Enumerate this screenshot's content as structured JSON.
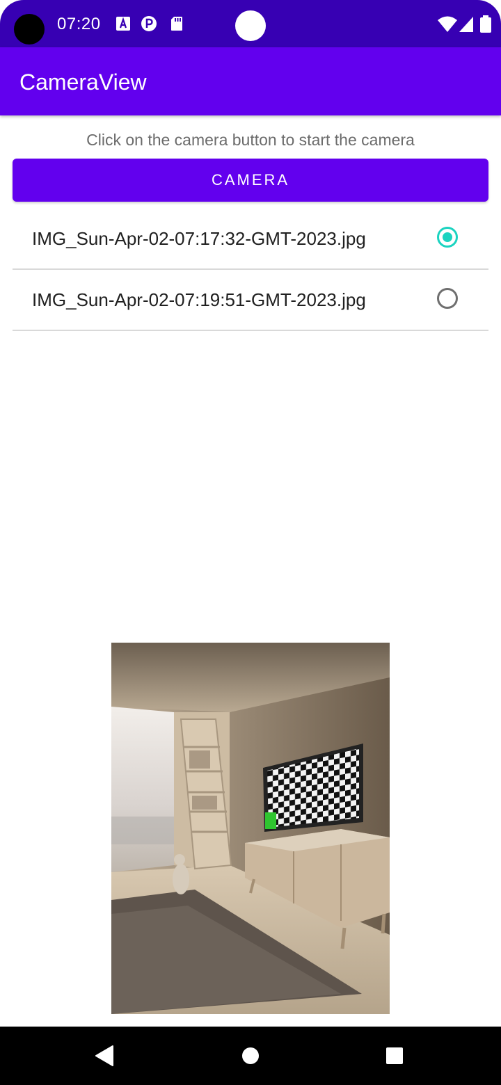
{
  "status_bar": {
    "time": "07:20",
    "notification_icons": [
      "text-a-icon",
      "p-circle-icon",
      "sd-card-icon"
    ],
    "right_icons": [
      "wifi-icon",
      "signal-icon",
      "battery-icon"
    ],
    "background_color": "#3700b3"
  },
  "app_bar": {
    "title": "CameraView",
    "background_color": "#6200ee"
  },
  "content": {
    "instruction": "Click on the camera button to start the camera",
    "camera_button_label": "CAMERA",
    "files": [
      {
        "name": "IMG_Sun-Apr-02-07:17:32-GMT-2023.jpg",
        "selected": true
      },
      {
        "name": "IMG_Sun-Apr-02-07:19:51-GMT-2023.jpg",
        "selected": false
      }
    ],
    "radio_accent_color": "#1bd3c0"
  },
  "photo": {
    "content": "room-with-tv-checkerboard"
  },
  "nav_bar": {
    "buttons": [
      "back-icon",
      "home-icon",
      "recents-icon"
    ]
  }
}
